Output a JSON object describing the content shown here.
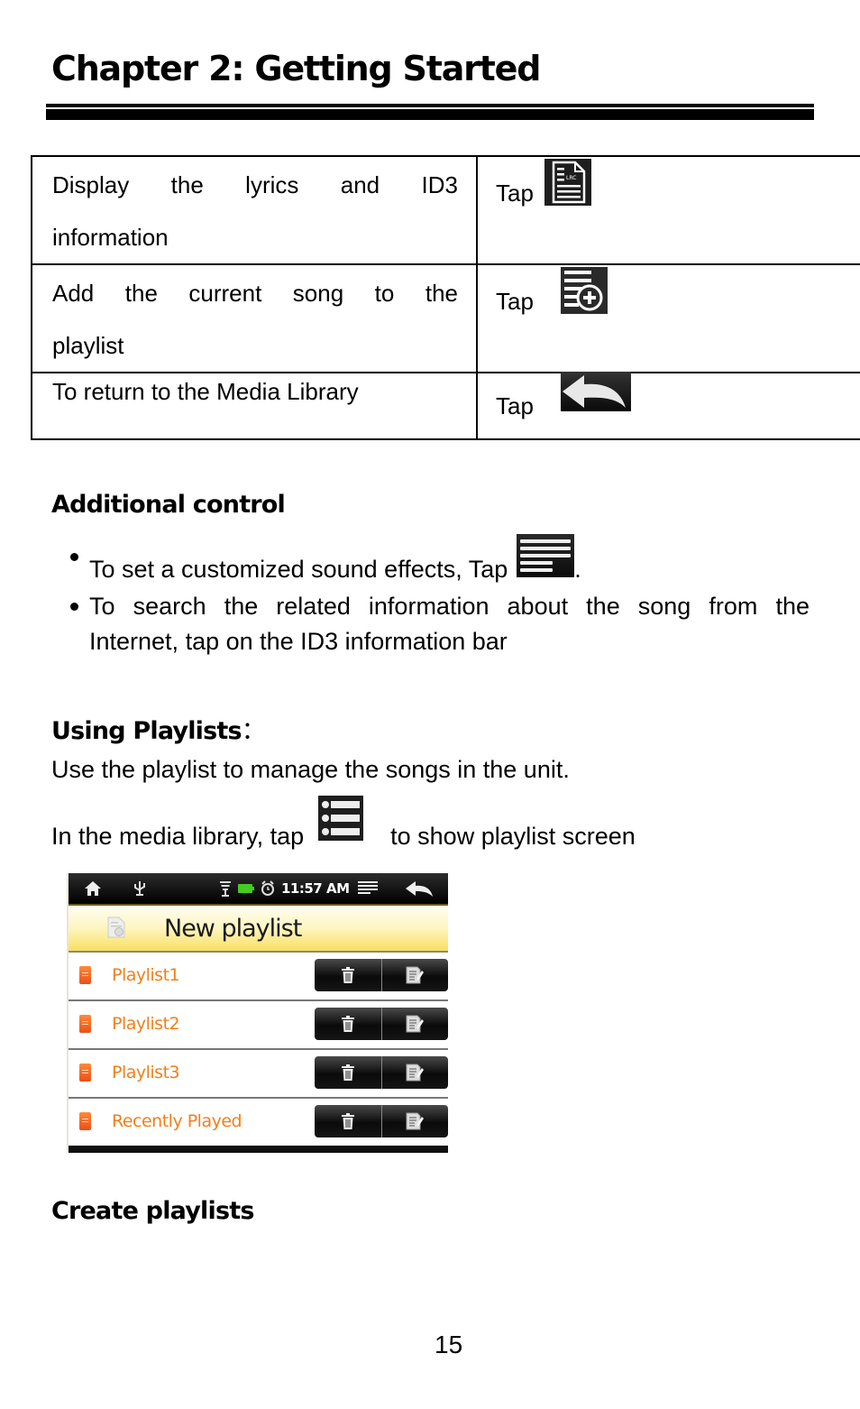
{
  "header": {
    "chapter_title": "Chapter 2: Getting Started"
  },
  "controls_table": {
    "rows": [
      {
        "description_line1": "Display the lyrics and ID3",
        "description_line2": "information",
        "action_label": "Tap",
        "icon": "lyrics-document-icon"
      },
      {
        "description_line1": "Add the current song to the",
        "description_line2": "playlist",
        "action_label": "Tap",
        "icon": "add-to-playlist-icon"
      },
      {
        "description_line1": "To return to the Media Library",
        "action_label": "Tap",
        "icon": "back-arrow-icon"
      }
    ]
  },
  "additional_control": {
    "heading": "Additional control",
    "bullets": [
      {
        "text_before_icon": "To set a customized sound effects, Tap",
        "icon": "menu-lines-icon",
        "text_after_icon": "."
      },
      {
        "line1": "To search the related information about the song from the",
        "line2": "Internet, tap on the ID3 information bar"
      }
    ]
  },
  "using_playlists": {
    "heading": "Using Playlists",
    "heading_suffix": "：",
    "line1": "Use the playlist to manage the songs in the unit.",
    "line2_before_icon": "In the media library, tap",
    "line2_icon": "playlist-list-icon",
    "line2_after_icon": "to show playlist screen"
  },
  "device_screen": {
    "status_bar": {
      "time": "11:57 AM",
      "icons": [
        "home-icon",
        "usb-icon",
        "wifi-icon",
        "battery-icon",
        "alarm-icon",
        "menu-icon",
        "back-icon"
      ],
      "battery_color": "#44cc22"
    },
    "title_bar": {
      "title": "New playlist",
      "icon": "new-playlist-icon"
    },
    "playlists": [
      {
        "name": "Playlist1",
        "delete_icon": "trash-icon",
        "edit_icon": "edit-icon"
      },
      {
        "name": "Playlist2",
        "delete_icon": "trash-icon",
        "edit_icon": "edit-icon"
      },
      {
        "name": "Playlist3",
        "delete_icon": "trash-icon",
        "edit_icon": "edit-icon"
      },
      {
        "name": "Recently Played",
        "delete_icon": "trash-icon",
        "edit_icon": "edit-icon"
      }
    ],
    "accent_color": "#f27f1a"
  },
  "create_playlists": {
    "heading": "Create playlists"
  },
  "footer": {
    "page_number": "15"
  }
}
